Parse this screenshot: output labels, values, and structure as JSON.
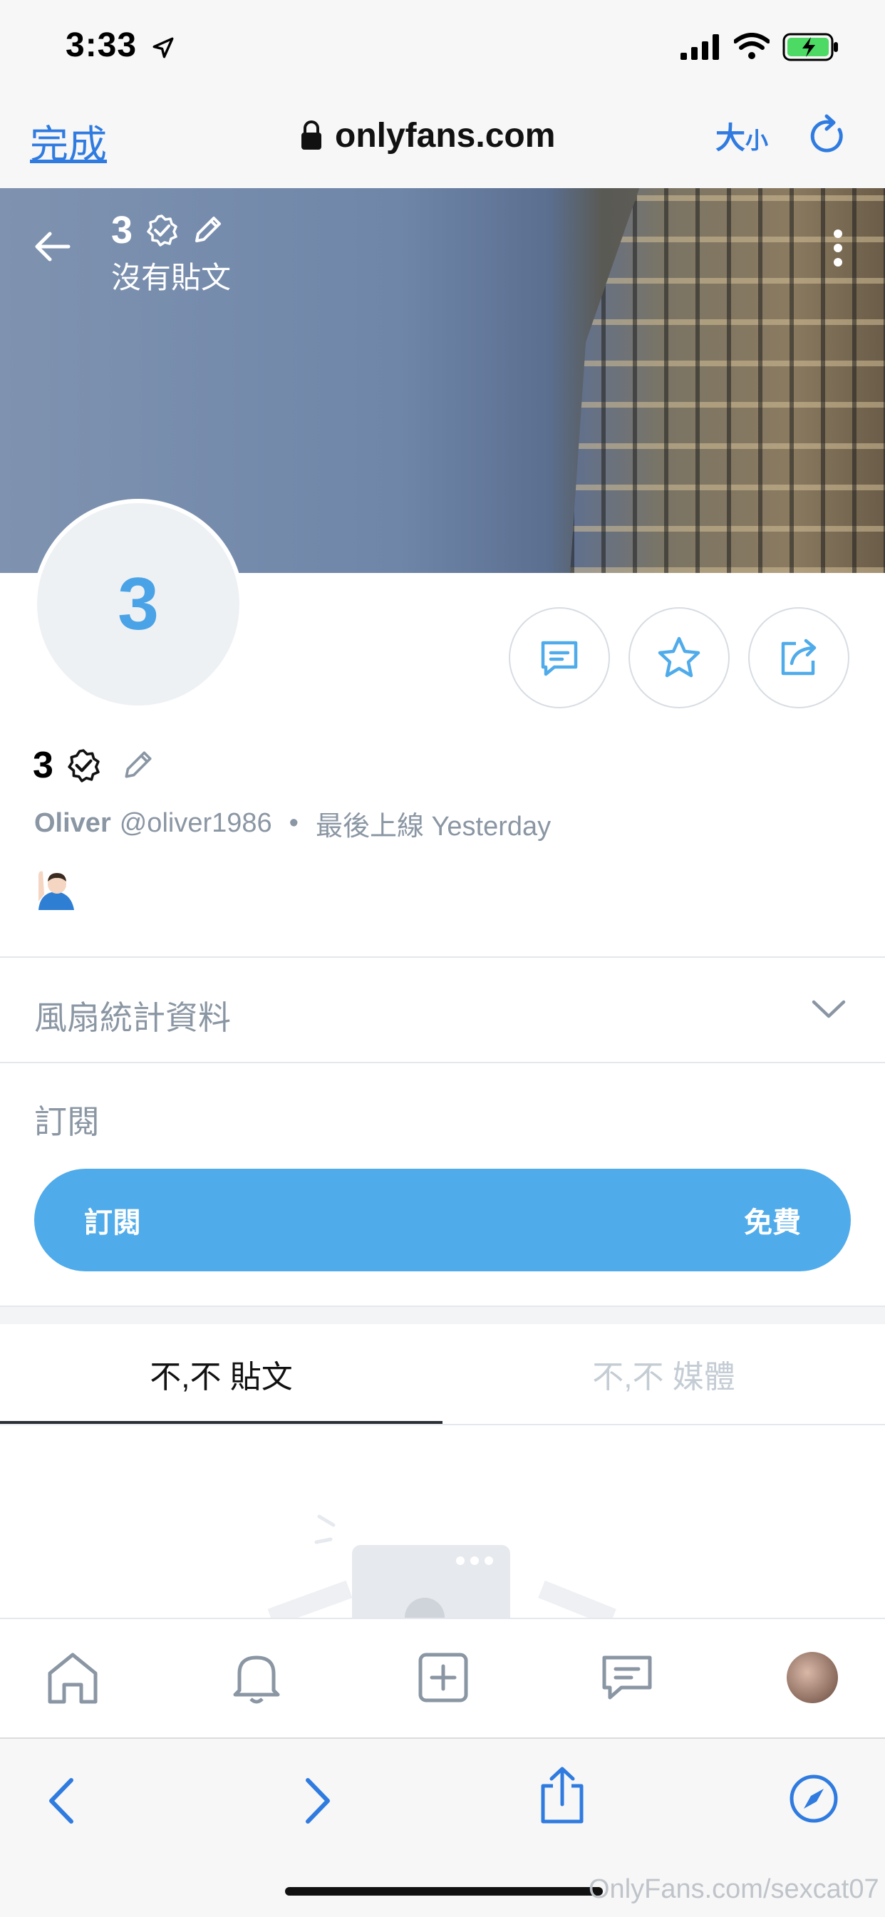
{
  "status_bar": {
    "time": "3:33"
  },
  "browser": {
    "done_label": "完成",
    "url": "onlyfans.com",
    "text_size_big": "大",
    "text_size_small": "小"
  },
  "banner": {
    "title": "3",
    "subtitle": "沒有貼文"
  },
  "profile": {
    "avatar_initial": "3",
    "name": "3",
    "display_name": "Oliver",
    "handle": "@oliver1986",
    "separator": "•",
    "last_seen": "最後上線 Yesterday"
  },
  "fan_stats": {
    "label": "風扇統計資料"
  },
  "subscription": {
    "section_label": "訂閱",
    "button_label": "訂閱",
    "price_label": "免費"
  },
  "tabs": [
    {
      "label": "不,不 貼文",
      "active": true
    },
    {
      "label": "不,不 媒體",
      "active": false
    }
  ],
  "watermark": "OnlyFans.com/sexcat07",
  "colors": {
    "accent": "#4fabea",
    "link_blue": "#2f7be0",
    "muted": "#8a96a3"
  },
  "icons": [
    "back-arrow-icon",
    "verified-badge-icon",
    "edit-pencil-icon",
    "more-vertical-icon",
    "message-icon",
    "star-icon",
    "share-icon",
    "chevron-down-icon",
    "home-icon",
    "bell-icon",
    "add-post-icon",
    "chat-icon",
    "profile-avatar",
    "safari-back-icon",
    "safari-forward-icon",
    "safari-share-icon",
    "safari-compass-icon",
    "lock-icon",
    "reload-icon"
  ]
}
